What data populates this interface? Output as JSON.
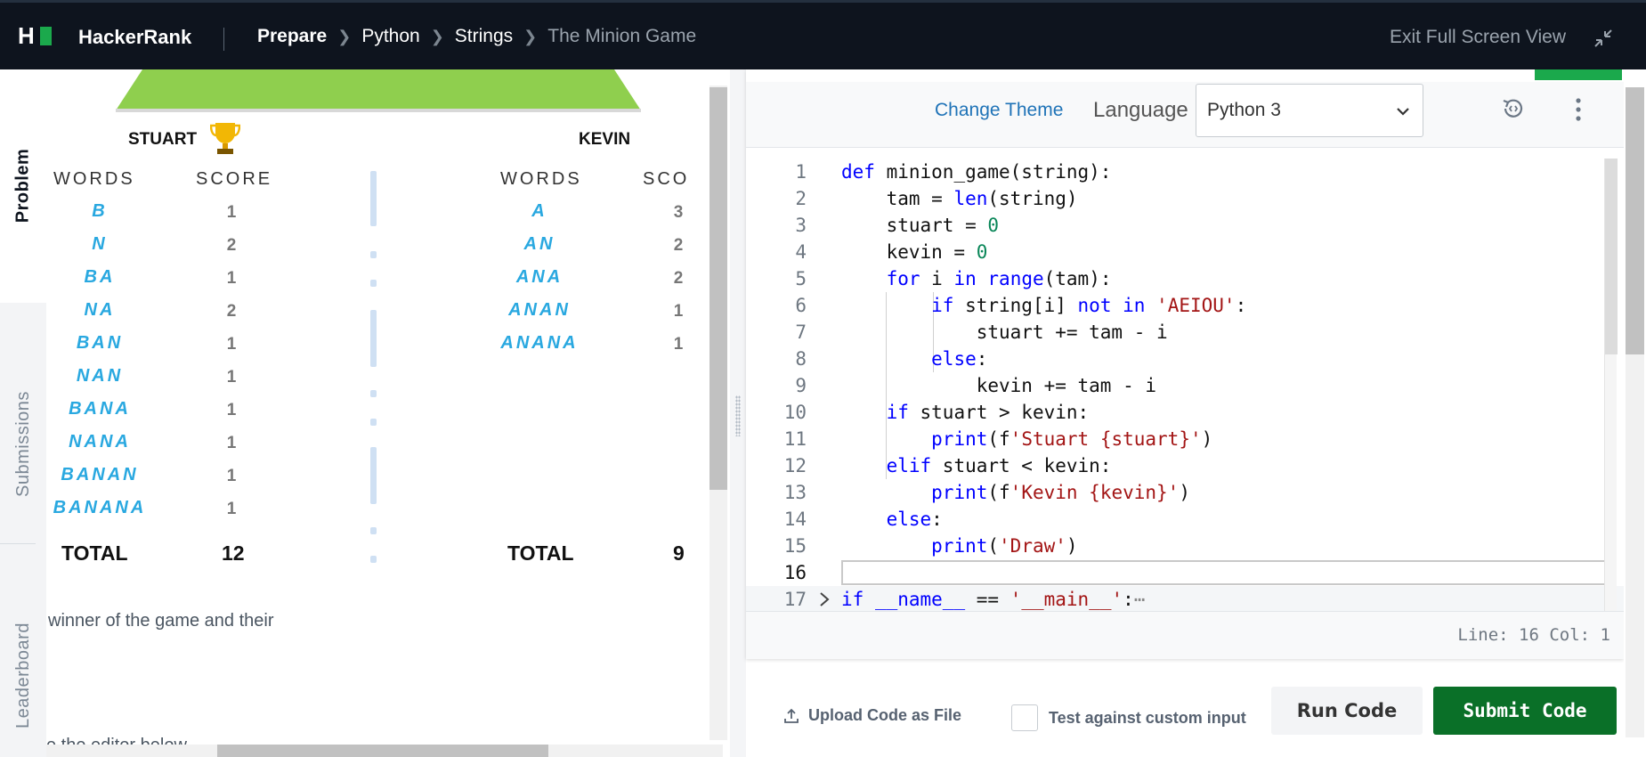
{
  "header": {
    "brand": "HackerRank",
    "breadcrumbs": [
      "Prepare",
      "Python",
      "Strings",
      "The Minion Game"
    ],
    "exit_fullscreen": "Exit Full Screen View"
  },
  "tabs": {
    "problem": "Problem",
    "submissions": "Submissions",
    "leaderboard": "Leaderboard"
  },
  "problem": {
    "players": [
      "STUART",
      "KEVIN"
    ],
    "col_words": "WORDS",
    "col_score": "SCORE",
    "col_score_cut": "SCOI",
    "stuart_words": [
      "B",
      "N",
      "BA",
      "NA",
      "BAN",
      "NAN",
      "BANA",
      "NANA",
      "BANAN",
      "BANANA"
    ],
    "stuart_scores": [
      "1",
      "2",
      "1",
      "2",
      "1",
      "1",
      "1",
      "1",
      "1",
      "1"
    ],
    "kevin_words": [
      "A",
      "AN",
      "ANA",
      "ANAN",
      "ANANA"
    ],
    "kevin_scores": [
      "3",
      "2",
      "2",
      "1",
      "1"
    ],
    "total_label": "TOTAL",
    "stuart_total": "12",
    "kevin_total": "9",
    "text_1": "winner of the game and their",
    "text_2": "e the editor below."
  },
  "editor": {
    "change_theme": "Change Theme",
    "language_label": "Language",
    "language_value": "Python 3",
    "status": "Line: 16 Col: 1",
    "line_numbers": [
      "1",
      "2",
      "3",
      "4",
      "5",
      "6",
      "7",
      "8",
      "9",
      "10",
      "11",
      "12",
      "13",
      "14",
      "15",
      "16",
      "17"
    ]
  },
  "actions": {
    "upload": "Upload Code as File",
    "custom_input": "Test against custom input",
    "run": "Run Code",
    "submit": "Submit Code"
  },
  "colors": {
    "topbar": "#0e141e",
    "brand_green": "#1ba94c",
    "submit_green": "#0a7028",
    "link_blue": "#1f73b7"
  }
}
